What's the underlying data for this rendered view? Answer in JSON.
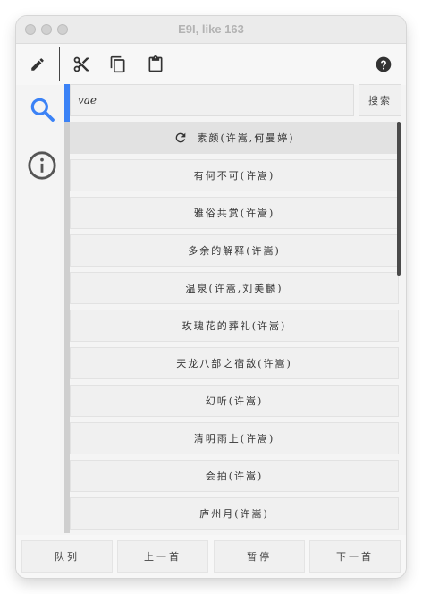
{
  "window": {
    "title": "E9I, like 163"
  },
  "toolbar": {
    "icons": [
      "pencil-icon",
      "scissors-icon",
      "copy-icon",
      "paste-icon",
      "help-icon"
    ]
  },
  "search": {
    "value": "vae",
    "button_label": "搜索"
  },
  "results": [
    {
      "label": "素颜(许嵩,何曼婷)",
      "active": true,
      "icon": "refresh-icon"
    },
    {
      "label": "有何不可(许嵩)"
    },
    {
      "label": "雅俗共赏(许嵩)"
    },
    {
      "label": "多余的解释(许嵩)"
    },
    {
      "label": "温泉(许嵩,刘美麟)"
    },
    {
      "label": "玫瑰花的葬礼(许嵩)"
    },
    {
      "label": "天龙八部之宿敌(许嵩)"
    },
    {
      "label": "幻听(许嵩)"
    },
    {
      "label": "清明雨上(许嵩)"
    },
    {
      "label": "会拍(许嵩)"
    },
    {
      "label": "庐州月(许嵩)"
    }
  ],
  "bottom": {
    "queue": "队列",
    "prev": "上一首",
    "pause": "暂停",
    "next": "下一首"
  },
  "colors": {
    "accent": "#3b82f6"
  }
}
